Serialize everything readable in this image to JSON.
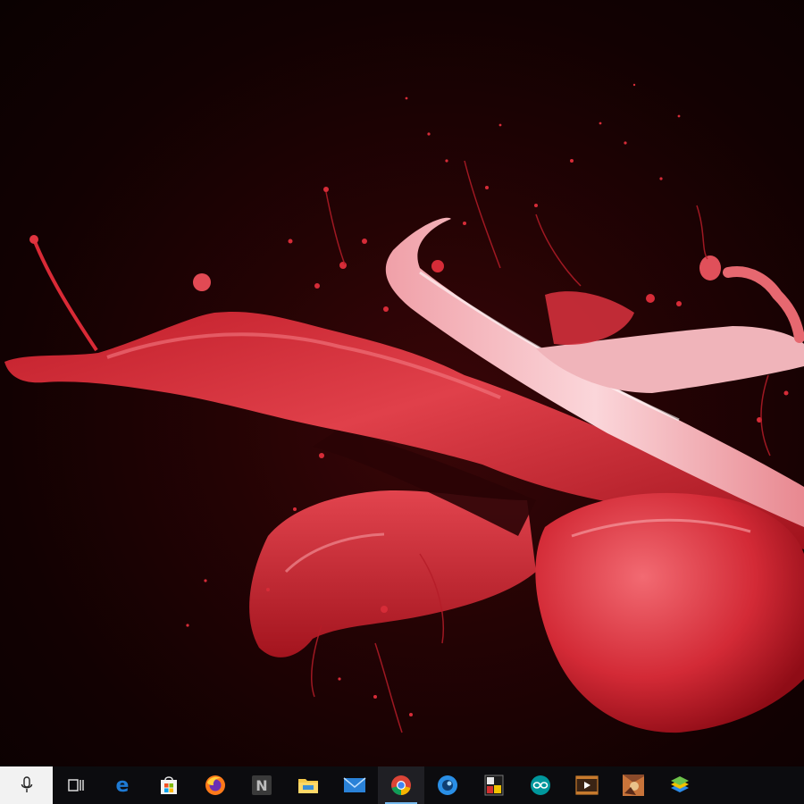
{
  "desktop": {
    "wallpaper": "red-paint-splash",
    "colors": {
      "background_dark": "#120102",
      "splash_main": "#d9303a",
      "splash_highlight": "#f6c4c8",
      "splash_shadow": "#8a0e16"
    }
  },
  "taskbar": {
    "background": "#0c0c0f",
    "accent": "#76b9ed",
    "search": {
      "icon": "microphone-icon",
      "background": "#f2f2f2"
    },
    "items": [
      {
        "icon": "task-view-icon",
        "active": false
      },
      {
        "icon": "edge-icon",
        "active": false
      },
      {
        "icon": "store-icon",
        "active": false
      },
      {
        "icon": "firefox-icon",
        "active": false
      },
      {
        "icon": "n-app-icon",
        "active": false
      },
      {
        "icon": "file-explorer-icon",
        "active": false
      },
      {
        "icon": "mail-icon",
        "active": false
      },
      {
        "icon": "chrome-icon",
        "active": true
      },
      {
        "icon": "blue-circle-app-icon",
        "active": false
      },
      {
        "icon": "ms-app-icon",
        "active": false
      },
      {
        "icon": "arduino-icon",
        "active": false
      },
      {
        "icon": "media-player-icon",
        "active": false
      },
      {
        "icon": "game-thumbnail-icon",
        "active": false
      },
      {
        "icon": "bluestacks-icon",
        "active": false
      }
    ]
  }
}
